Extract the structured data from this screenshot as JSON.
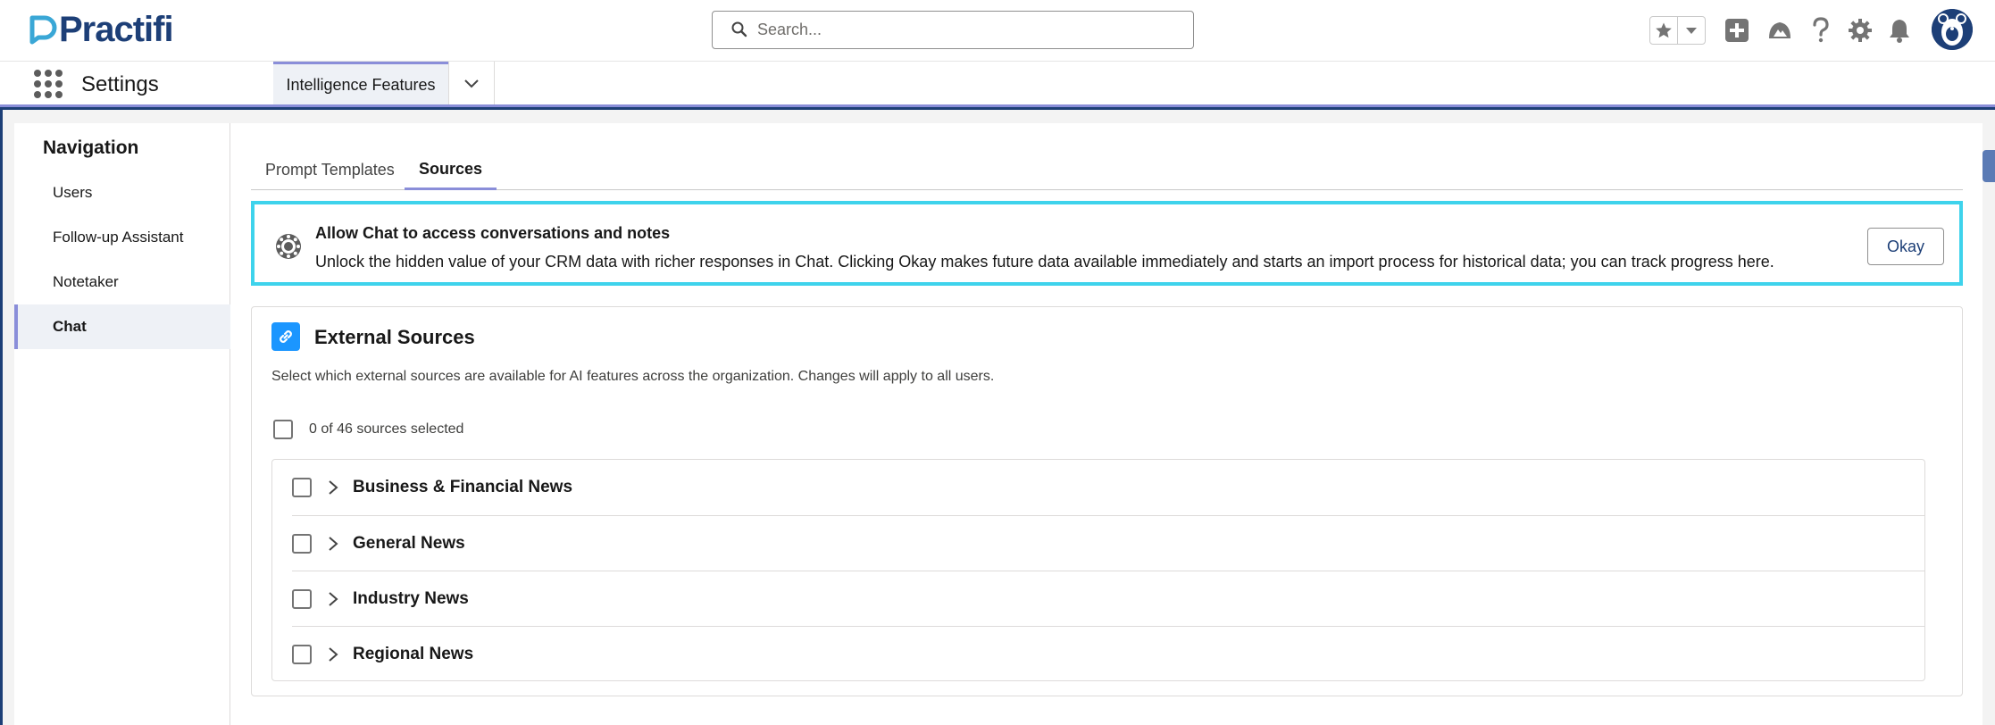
{
  "header": {
    "brand": "Practifi",
    "search_placeholder": "Search..."
  },
  "app_nav": {
    "app_name": "Settings",
    "active_tab": "Intelligence Features"
  },
  "side_nav": {
    "title": "Navigation",
    "items": [
      {
        "label": "Users"
      },
      {
        "label": "Follow-up Assistant"
      },
      {
        "label": "Notetaker"
      },
      {
        "label": "Chat"
      }
    ],
    "active_item": "Chat"
  },
  "tabs": [
    {
      "label": "Prompt Templates"
    },
    {
      "label": "Sources"
    }
  ],
  "active_tab": "Sources",
  "banner": {
    "title": "Allow Chat to access conversations and notes",
    "text": "Unlock the hidden value of your CRM data with richer responses in Chat. Clicking Okay makes future data available immediately and starts an import process for historical data; you can track progress here.",
    "button_label": "Okay"
  },
  "external_sources": {
    "title": "External Sources",
    "description": "Select which external sources are available for AI features across the organization. Changes will apply to all users.",
    "selection_summary": "0 of 46 sources selected",
    "groups": [
      {
        "label": "Business & Financial News"
      },
      {
        "label": "General News"
      },
      {
        "label": "Industry News"
      },
      {
        "label": "Regional News"
      }
    ]
  },
  "colors": {
    "brand_navy": "#1d3f77",
    "accent_lavender": "#8a8ed9",
    "banner_border": "#3ed3ec",
    "link_icon_blue": "#1b96ff"
  }
}
